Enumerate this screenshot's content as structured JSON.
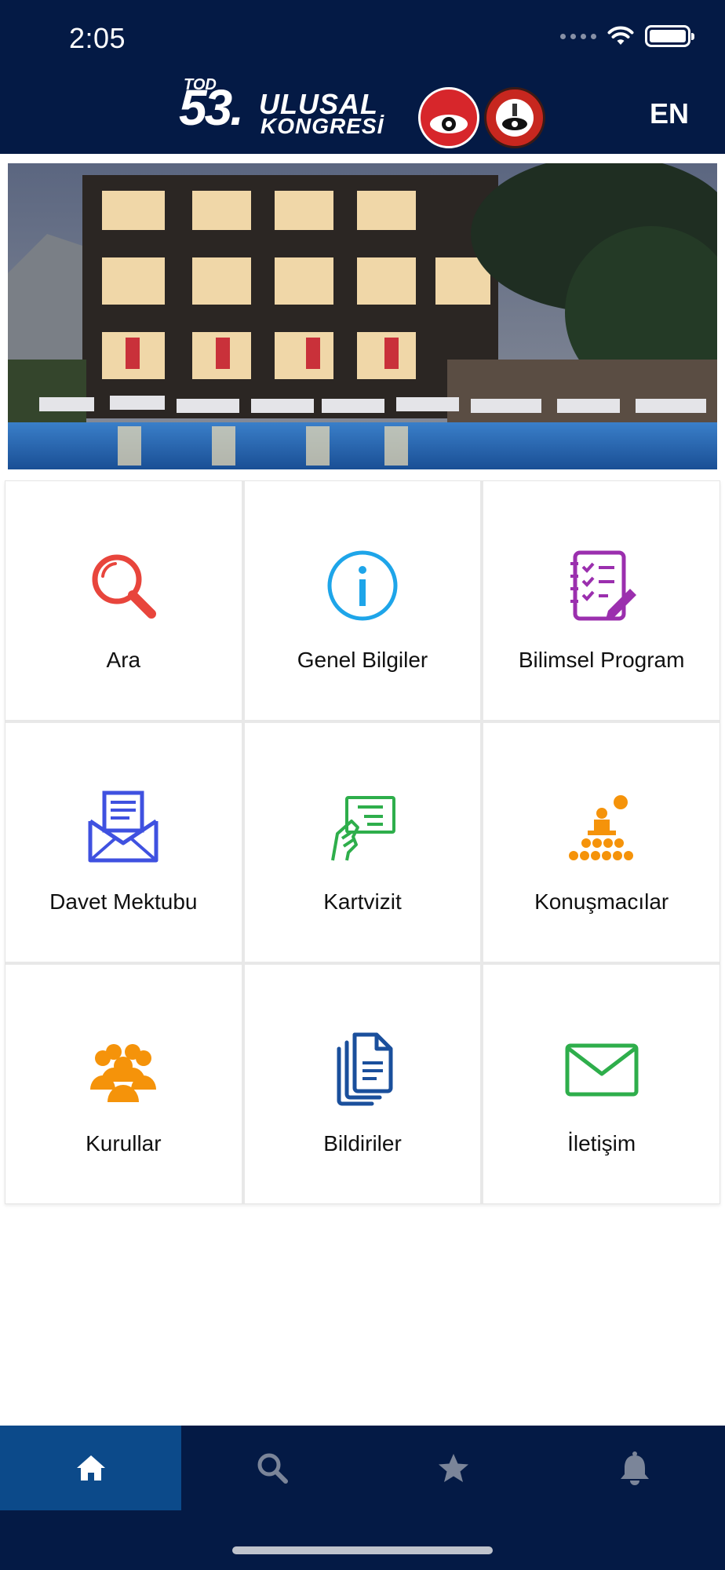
{
  "status_bar": {
    "time": "2:05"
  },
  "header": {
    "logo": {
      "tod": "TOD",
      "number": "53.",
      "line1": "ULUSAL",
      "line2": "KONGRESİ"
    },
    "language_button": "EN"
  },
  "menu": [
    {
      "label": "Ara",
      "icon": "search-icon",
      "color": "#e8453c"
    },
    {
      "label": "Genel Bilgiler",
      "icon": "info-icon",
      "color": "#1ea5e9"
    },
    {
      "label": "Bilimsel Program",
      "icon": "checklist-notebook-icon",
      "color": "#9b2fae"
    },
    {
      "label": "Davet Mektubu",
      "icon": "envelope-letter-icon",
      "color": "#3f51e0"
    },
    {
      "label": "Kartvizit",
      "icon": "business-card-hand-icon",
      "color": "#2eae4b"
    },
    {
      "label": "Konuşmacılar",
      "icon": "speaker-audience-icon",
      "color": "#f5930a"
    },
    {
      "label": "Kurullar",
      "icon": "group-icon",
      "color": "#f5930a"
    },
    {
      "label": "Bildiriler",
      "icon": "documents-icon",
      "color": "#1a4f9c"
    },
    {
      "label": "İletişim",
      "icon": "mail-icon",
      "color": "#2eae4b"
    }
  ],
  "bottom_nav": [
    {
      "icon": "home-icon",
      "active": true
    },
    {
      "icon": "search-icon",
      "active": false
    },
    {
      "icon": "star-icon",
      "active": false
    },
    {
      "icon": "bell-icon",
      "active": false
    }
  ]
}
